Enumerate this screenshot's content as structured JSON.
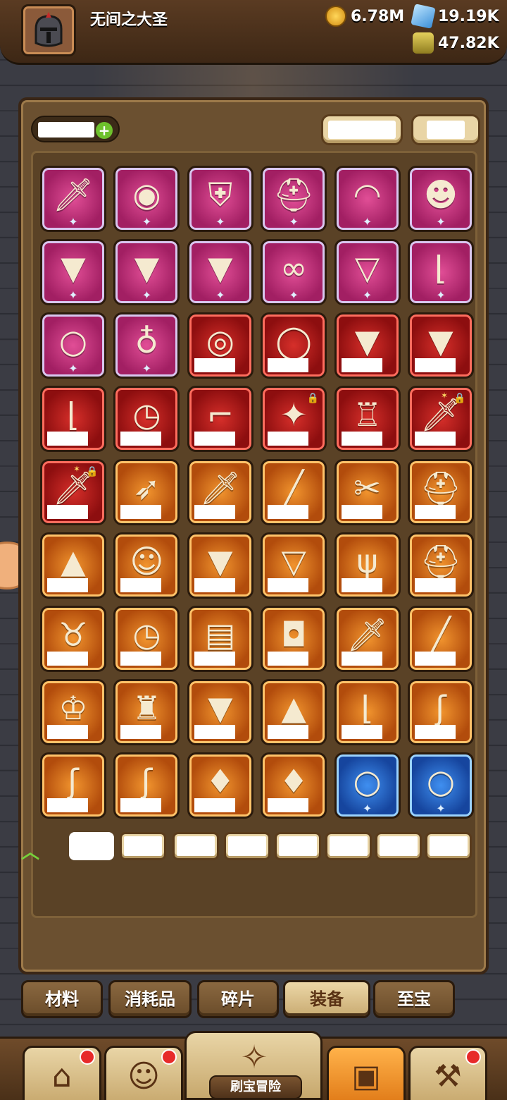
{
  "player": {
    "name": "无间之大圣"
  },
  "resources": {
    "gold": "6.78M",
    "gems": "19.19K",
    "potion": "47.82K"
  },
  "colors": {
    "epic": "#a21f63",
    "legendary": "#8d0e0f",
    "rare": "#b24c0c",
    "uncommon": "#16459e",
    "active_tab": "#ecd7a7"
  },
  "inventory": {
    "rows": [
      [
        "sword-icon",
        "shield-round-icon",
        "crest-shield-icon",
        "helmet-icon",
        "hat-icon",
        "mask-icon"
      ],
      [
        "armor-icon",
        "armor-icon",
        "armor-icon",
        "bra-icon",
        "cape-icon",
        "boot-icon"
      ],
      [
        "bracelet-icon",
        "necklace-icon",
        "orb-icon",
        "ring-icon",
        "armor-icon",
        "armor-icon"
      ],
      [
        "boot-icon",
        "pocket-watch-icon",
        "revolver-icon",
        "fan-icon",
        "coat-icon",
        "sword-icon"
      ],
      [
        "sword-icon",
        "spear-icon",
        "sword-icon",
        "broom-icon",
        "knife-icon",
        "helmet-icon"
      ],
      [
        "wizard-hat-icon",
        "cat-mask-icon",
        "armor-icon",
        "cape-icon",
        "claw-icon",
        "helmet-icon"
      ],
      [
        "beast-icon",
        "pocket-watch-icon",
        "scroll-icon",
        "lantern-icon",
        "sword-icon",
        "broom-icon"
      ],
      [
        "crown-icon",
        "fur-icon",
        "armor-icon",
        "rock-icon",
        "boot-icon",
        "rope-icon"
      ],
      [
        "rope-icon",
        "rope-icon",
        "pendant-icon",
        "pendant-icon",
        "bracelet-icon",
        "bracelet-icon"
      ]
    ]
  },
  "tabs": [
    "材料",
    "消耗品",
    "碎片",
    "装备",
    "至宝"
  ],
  "active_tab": "装备",
  "bottom_nav": {
    "center_label": "刷宝冒险"
  }
}
